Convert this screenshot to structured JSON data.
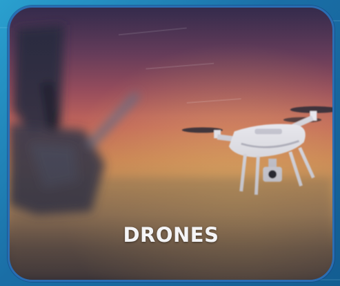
{
  "card": {
    "label": "DRONES",
    "image_icon": "drone-photo",
    "border_color": "#2a6db3"
  },
  "background": {
    "color": "#1f7fb3"
  }
}
